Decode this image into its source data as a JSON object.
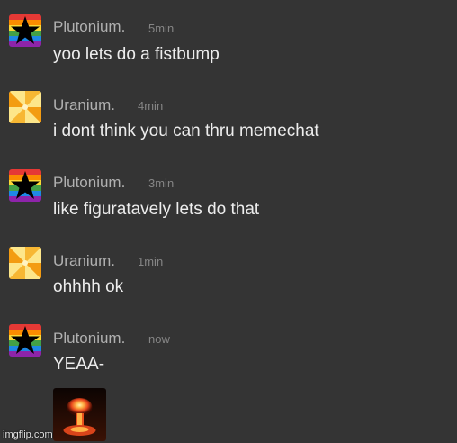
{
  "messages": [
    {
      "author": "Plutonium.",
      "time": "5min",
      "text": "yoo lets do a fistbump",
      "avatar": "rainbow-star-icon"
    },
    {
      "author": "Uranium.",
      "time": "4min",
      "text": "i dont think you can thru memechat",
      "avatar": "radiation-burst-icon"
    },
    {
      "author": "Plutonium.",
      "time": "3min",
      "text": "like figuratavely lets do that",
      "avatar": "rainbow-star-icon"
    },
    {
      "author": "Uranium.",
      "time": "1min",
      "text": "ohhhh ok",
      "avatar": "radiation-burst-icon"
    },
    {
      "author": "Plutonium.",
      "time": "now",
      "text": "YEAA-",
      "avatar": "rainbow-star-icon",
      "attachment": "mushroom-cloud-image"
    }
  ],
  "watermark": "imgflip.com",
  "colors": {
    "background": "#343434",
    "username": "#b0b0b0",
    "timestamp": "#858585",
    "message_text": "#ededed"
  }
}
